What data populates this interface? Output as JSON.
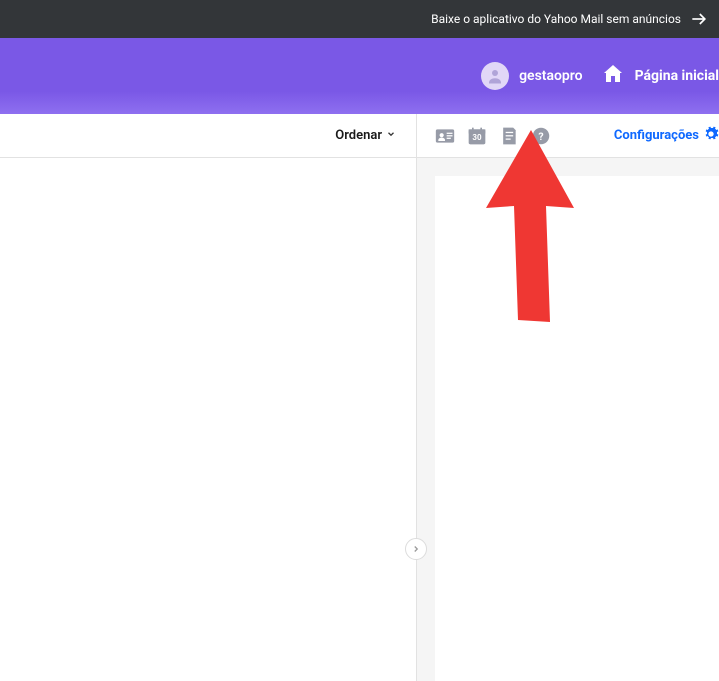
{
  "banner": {
    "text": "Baixe o aplicativo do Yahoo Mail sem anúncios"
  },
  "header": {
    "username": "gestaopro",
    "home_label": "Página inicial"
  },
  "toolbar": {
    "sort_label": "Ordenar",
    "config_label": "Configurações",
    "icons": {
      "contacts": "contacts-card-icon",
      "calendar": "calendar-icon",
      "calendar_day": "30",
      "notepad": "notepad-icon",
      "help": "help-icon"
    }
  },
  "annotation": {
    "arrow_color": "#ef3733"
  }
}
